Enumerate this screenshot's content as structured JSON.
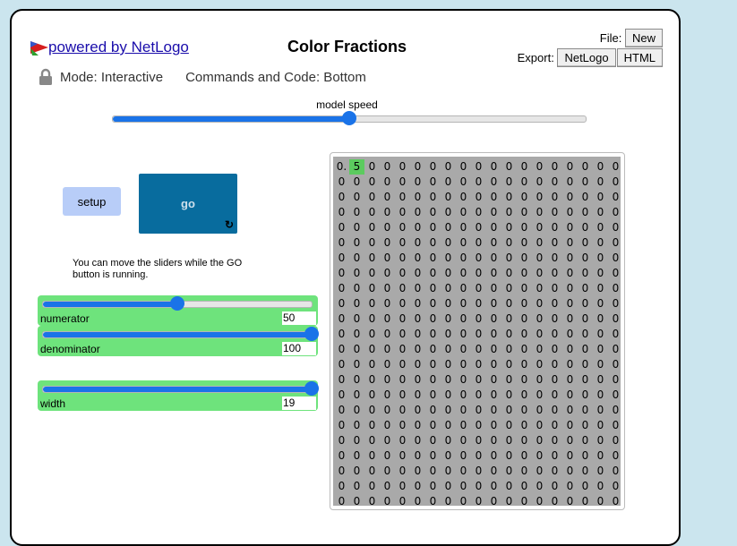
{
  "header": {
    "powered_by": "powered by NetLogo",
    "title": "Color Fractions",
    "file_label": "File:",
    "new_label": "New",
    "export_label": "Export:",
    "export_netlogo": "NetLogo",
    "export_html": "HTML"
  },
  "mode": {
    "mode_text": "Mode: Interactive",
    "commands_text": "Commands and Code: Bottom"
  },
  "speed": {
    "label": "model speed",
    "level": 0.5
  },
  "buttons": {
    "setup": "setup",
    "go": "go",
    "forever_icon": "↻"
  },
  "note": "You can move the sliders while the GO button is running.",
  "sliders": [
    {
      "label": "numerator",
      "value": "50",
      "min": 0,
      "max": 100,
      "current": 50
    },
    {
      "label": "denominator",
      "value": "100",
      "min": 1,
      "max": 100,
      "current": 100
    },
    {
      "label": "width",
      "value": "19",
      "min": 1,
      "max": 19,
      "current": 19
    }
  ],
  "view": {
    "cols": 19,
    "rows": 23,
    "default_char": "0",
    "first_row": [
      "0.",
      "5"
    ],
    "highlight_color": "#5ccb5f"
  }
}
